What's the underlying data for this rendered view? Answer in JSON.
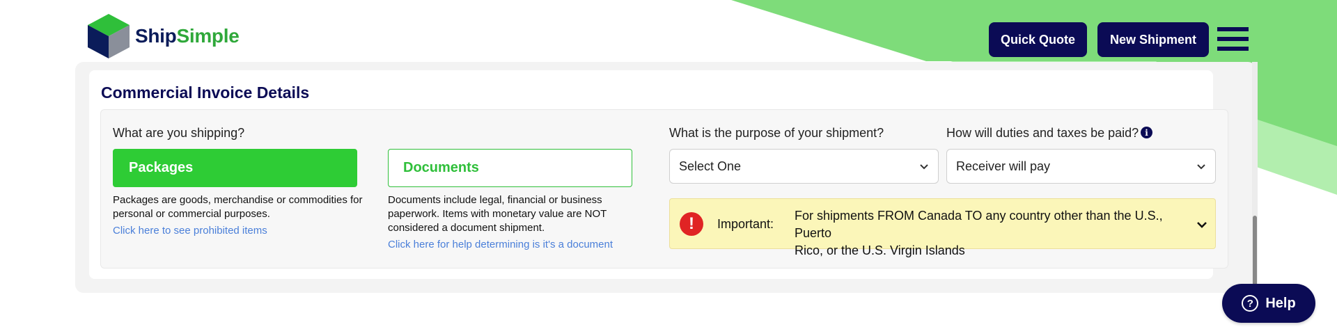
{
  "brand": {
    "ship": "Ship",
    "simple": "Simple"
  },
  "header": {
    "quick_quote": "Quick Quote",
    "new_shipment": "New Shipment",
    "menu_icon": "hamburger-menu-icon"
  },
  "colors": {
    "navy": "#0b0b55",
    "green": "#2ecc35",
    "bg_green": "#7edc7a",
    "bg_green_light": "#b2eeae",
    "notice_bg": "#fbf6b9",
    "alert_red": "#e02424",
    "link_blue": "#4a7fd9"
  },
  "section": {
    "title": "Commercial Invoice Details"
  },
  "shipping_type": {
    "question": "What are you shipping?",
    "packages": {
      "label": "Packages",
      "selected": true,
      "desc_line1": "Packages are goods, merchandise or commodities for",
      "desc_line2": "personal or commercial purposes.",
      "link": "Click here to see prohibited items"
    },
    "documents": {
      "label": "Documents",
      "selected": false,
      "desc_line1": "Documents include legal, financial or business",
      "desc_line2": "paperwork. Items with monetary value are NOT",
      "desc_line3": "considered a document shipment.",
      "link": "Click here for help determining is it's a document"
    }
  },
  "purpose": {
    "question": "What is the purpose of your shipment?",
    "value": "Select One"
  },
  "duties": {
    "question": "How will duties and taxes be paid?",
    "value": "Receiver will pay",
    "info_icon": "info-icon"
  },
  "notice": {
    "icon": "!",
    "label": "Important:",
    "text_line1": "For shipments FROM Canada TO any country other than the U.S., Puerto",
    "text_line2": "Rico, or the U.S. Virgin Islands"
  },
  "help": {
    "icon": "?",
    "label": "Help"
  }
}
